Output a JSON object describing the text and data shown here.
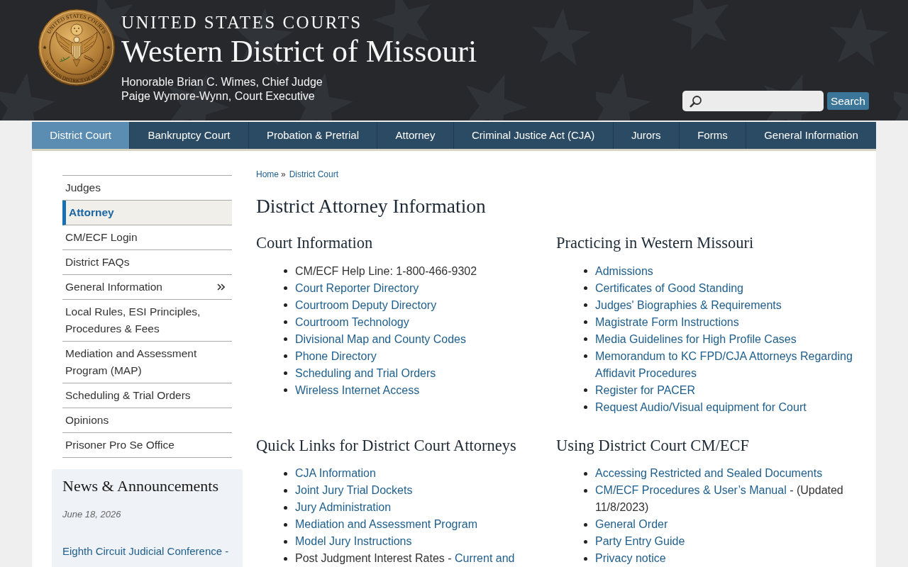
{
  "header": {
    "seal": {
      "top_text": "UNITED STATES COURTS",
      "bottom_text": "WESTERN DISTRICT OF MISSOURI"
    },
    "kicker": "UNITED STATES COURTS",
    "title": "Western District of Missouri",
    "officials": [
      "Honorable Brian C. Wimes, Chief Judge",
      "Paige Wymore-Wynn, Court Executive"
    ],
    "search": {
      "button": "Search"
    }
  },
  "nav": [
    {
      "label": "District Court",
      "selected": true
    },
    {
      "label": "Bankruptcy Court",
      "selected": false
    },
    {
      "label": "Probation & Pretrial",
      "selected": false
    },
    {
      "label": "Attorney",
      "selected": false
    },
    {
      "label": "Criminal Justice Act (CJA)",
      "selected": false
    },
    {
      "label": "Jurors",
      "selected": false
    },
    {
      "label": "Forms",
      "selected": false
    },
    {
      "label": "General Information",
      "selected": false
    }
  ],
  "sidebar": {
    "items": [
      {
        "label": "Judges",
        "selected": false,
        "has_submenu": false
      },
      {
        "label": "Attorney",
        "selected": true,
        "has_submenu": false
      },
      {
        "label": "CM/ECF Login",
        "selected": false,
        "has_submenu": false
      },
      {
        "label": "District FAQs",
        "selected": false,
        "has_submenu": false
      },
      {
        "label": "General Information",
        "selected": false,
        "has_submenu": true
      },
      {
        "label": "Local Rules, ESI Principles, Procedures & Fees",
        "selected": false,
        "has_submenu": false
      },
      {
        "label": "Mediation and Assessment Program (MAP)",
        "selected": false,
        "has_submenu": false
      },
      {
        "label": "Scheduling & Trial Orders",
        "selected": false,
        "has_submenu": false
      },
      {
        "label": "Opinions",
        "selected": false,
        "has_submenu": false
      },
      {
        "label": "Prisoner Pro Se Office",
        "selected": false,
        "has_submenu": false
      }
    ]
  },
  "news": {
    "title": "News & Announcements",
    "items": [
      {
        "date": "June 18, 2026",
        "link": "Eighth Circuit Judicial Conference -"
      }
    ]
  },
  "breadcrumb": {
    "items": [
      "Home",
      "District Court"
    ],
    "separator": "»"
  },
  "page_title": "District Attorney Information",
  "sections": [
    {
      "heading": "Court Information",
      "items": [
        {
          "parts": [
            {
              "kind": "text",
              "text": "CM/ECF Help Line: 1-800-466-9302"
            }
          ]
        },
        {
          "parts": [
            {
              "kind": "link",
              "text": "Court Reporter Directory"
            }
          ]
        },
        {
          "parts": [
            {
              "kind": "link",
              "text": "Courtroom Deputy Directory"
            }
          ]
        },
        {
          "parts": [
            {
              "kind": "link",
              "text": "Courtroom Technology"
            }
          ]
        },
        {
          "parts": [
            {
              "kind": "link",
              "text": "Divisional Map and County Codes"
            }
          ]
        },
        {
          "parts": [
            {
              "kind": "link",
              "text": "Phone Directory"
            }
          ]
        },
        {
          "parts": [
            {
              "kind": "link",
              "text": "Scheduling and Trial Orders"
            }
          ]
        },
        {
          "parts": [
            {
              "kind": "link",
              "text": "Wireless Internet Access"
            }
          ]
        }
      ]
    },
    {
      "heading": "Practicing in Western Missouri",
      "items": [
        {
          "parts": [
            {
              "kind": "link",
              "text": "Admissions"
            }
          ]
        },
        {
          "parts": [
            {
              "kind": "link",
              "text": "Certificates of Good Standing"
            }
          ]
        },
        {
          "parts": [
            {
              "kind": "link",
              "text": "Judges' Biographies & Requirements"
            }
          ]
        },
        {
          "parts": [
            {
              "kind": "link",
              "text": "Magistrate Form Instructions"
            }
          ]
        },
        {
          "parts": [
            {
              "kind": "link",
              "text": "Media Guidelines for High Profile Cases"
            }
          ]
        },
        {
          "parts": [
            {
              "kind": "link",
              "text": "Memorandum to KC FPD/CJA Attorneys Regarding Affidavit Procedures"
            }
          ]
        },
        {
          "parts": [
            {
              "kind": "link",
              "text": "Register for PACER"
            }
          ]
        },
        {
          "parts": [
            {
              "kind": "link",
              "text": "Request Audio/Visual equipment for Court"
            }
          ]
        }
      ]
    },
    {
      "heading": "Quick Links for District Court Attorneys",
      "items": [
        {
          "parts": [
            {
              "kind": "link",
              "text": "CJA Information"
            }
          ]
        },
        {
          "parts": [
            {
              "kind": "link",
              "text": "Joint Jury Trial Dockets"
            }
          ]
        },
        {
          "parts": [
            {
              "kind": "link",
              "text": "Jury Administration"
            }
          ]
        },
        {
          "parts": [
            {
              "kind": "link",
              "text": "Mediation and Assessment Program"
            }
          ]
        },
        {
          "parts": [
            {
              "kind": "link",
              "text": "Model Jury Instructions"
            }
          ]
        },
        {
          "parts": [
            {
              "kind": "text",
              "text": "Post Judgment Interest Rates -"
            },
            {
              "kind": "link",
              "text": "Current and"
            }
          ]
        }
      ]
    },
    {
      "heading": "Using District Court CM/ECF",
      "items": [
        {
          "parts": [
            {
              "kind": "link",
              "text": "Accessing Restricted and Sealed Documents"
            }
          ]
        },
        {
          "parts": [
            {
              "kind": "link",
              "text": "CM/ECF Procedures & User’s Manual"
            },
            {
              "kind": "text",
              "text": "- (Updated 11/8/2023)"
            }
          ]
        },
        {
          "parts": [
            {
              "kind": "link",
              "text": "General Order"
            }
          ]
        },
        {
          "parts": [
            {
              "kind": "link",
              "text": "Party Entry Guide"
            }
          ]
        },
        {
          "parts": [
            {
              "kind": "link",
              "text": "Privacy notice"
            }
          ]
        }
      ]
    }
  ]
}
